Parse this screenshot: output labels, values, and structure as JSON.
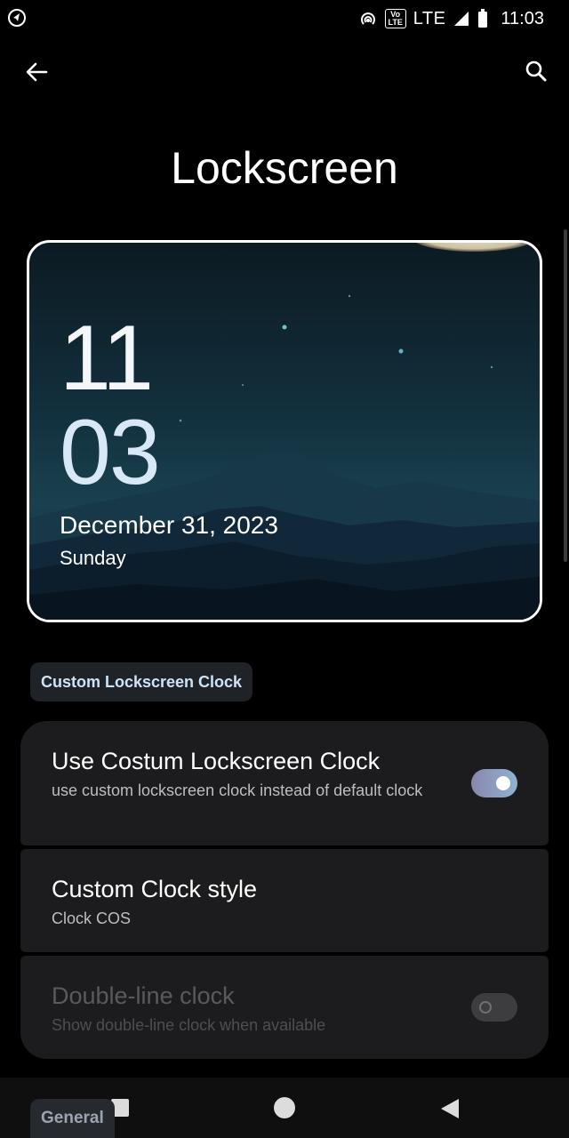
{
  "status_bar": {
    "lte_label": "LTE",
    "volte_label": "Vo LTE",
    "time": "11:03"
  },
  "header": {
    "title": "Lockscreen"
  },
  "preview": {
    "hour": "11",
    "minute": "03",
    "date": "December 31, 2023",
    "day": "Sunday"
  },
  "section": {
    "label": "Custom Lockscreen Clock"
  },
  "settings": [
    {
      "title": "Use Costum Lockscreen Clock",
      "subtitle": "use custom lockscreen clock instead of default clock",
      "toggle": "on"
    },
    {
      "title": "Custom Clock style",
      "subtitle": "Clock COS"
    },
    {
      "title": "Double-line clock",
      "subtitle": "Show double-line clock when available",
      "toggle": "off",
      "disabled": true
    }
  ],
  "bottom_tab": {
    "label": "General"
  },
  "colors": {
    "background": "#000000",
    "card": "#1c1c1e",
    "accent": "#8fb3d2",
    "chip_text": "#cfe3f6"
  }
}
